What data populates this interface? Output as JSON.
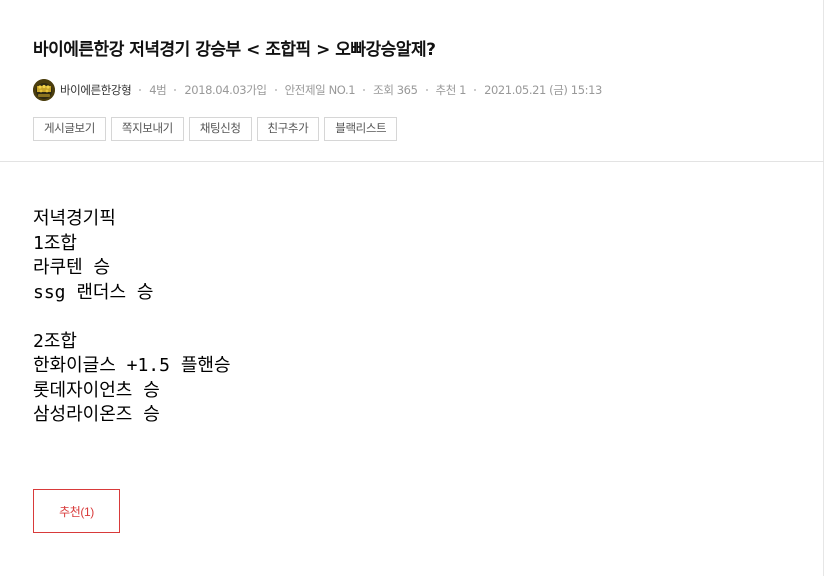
{
  "post": {
    "title": "바이에른한강 저녁경기 강승부 < 조합픽 > 오빠강승알제?",
    "author": "바이에른한강형",
    "level": "4범",
    "joined": "2018.04.03가입",
    "safety": "안전제일 NO.1",
    "views": "조회 365",
    "recommends": "추천 1",
    "datetime": "2021.05.21 (금) 15:13"
  },
  "actions": [
    "게시글보기",
    "쪽지보내기",
    "채팅신청",
    "친구추가",
    "블랙리스트"
  ],
  "content": [
    "저녁경기픽",
    "1조합",
    "라쿠텐 승",
    "ssg 랜더스 승",
    "",
    "2조합",
    "한화이글스 +1.5 플핸승",
    "롯데자이언츠 승",
    "삼성라이온즈 승"
  ],
  "recommend_button": "추천(1)",
  "colors": {
    "accent": "#d83a3a",
    "meta_text": "#999999",
    "border": "#d6d6d6"
  },
  "icons": {
    "avatar": "avatar-icon"
  }
}
